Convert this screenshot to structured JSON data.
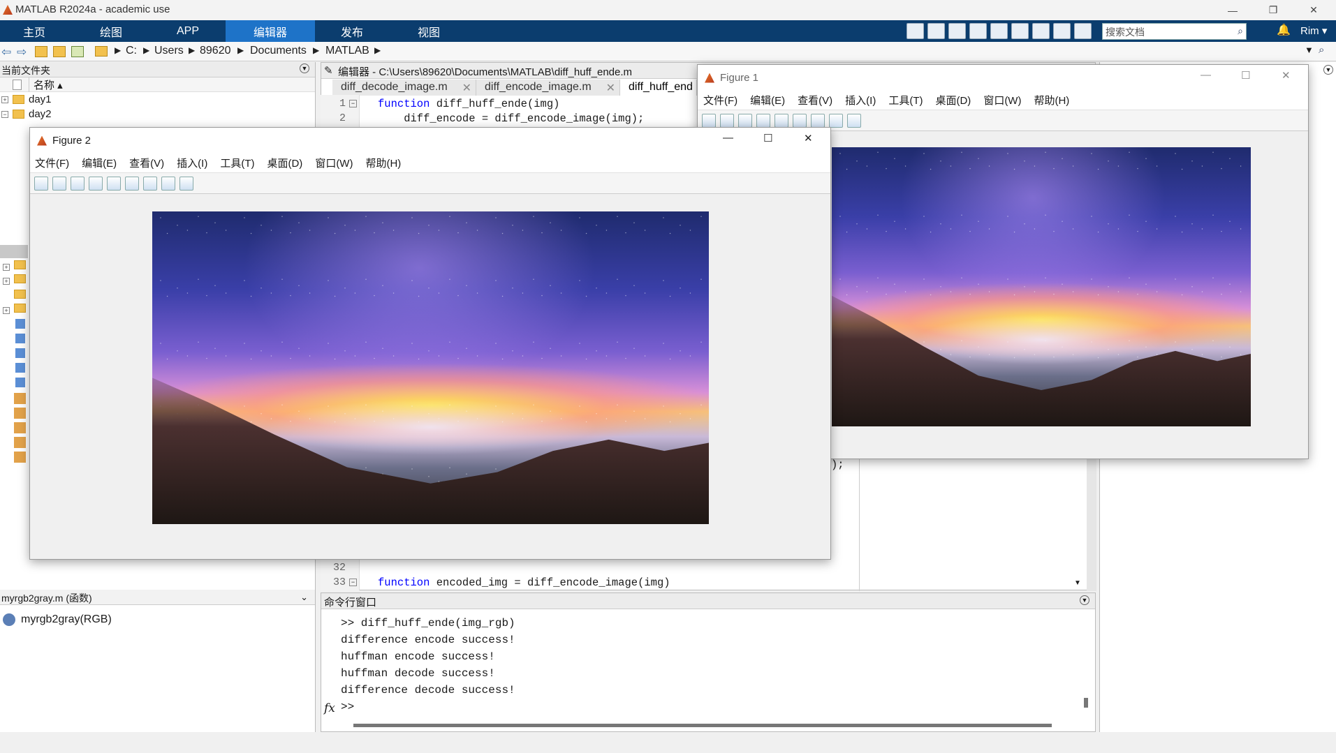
{
  "window": {
    "title": "MATLAB R2024a - academic use"
  },
  "ribbon": {
    "tabs": [
      "主页",
      "绘图",
      "APP",
      "编辑器",
      "发布",
      "视图"
    ],
    "active_tab": "编辑器",
    "search_placeholder": "搜索文档",
    "user": "Rim ▾"
  },
  "address": {
    "parts": [
      "C:",
      "Users",
      "89620",
      "Documents",
      "MATLAB"
    ]
  },
  "current_folder": {
    "title": "当前文件夹",
    "column_name": "名称 ▴",
    "items": [
      "day1",
      "day2"
    ]
  },
  "details": {
    "title": "myrgb2gray.m  (函数)",
    "function_sig": "myrgb2gray(RGB)"
  },
  "editor": {
    "header": "编辑器 - C:\\Users\\89620\\Documents\\MATLAB\\diff_huff_ende.m",
    "tabs": [
      "diff_decode_image.m",
      "diff_encode_image.m",
      "diff_huff_end"
    ],
    "active_tab": "diff_huff_end",
    "lines": [
      {
        "num": "1",
        "kw": "function",
        "code": " diff_huff_ende(img)"
      },
      {
        "num": "2",
        "kw": "",
        "code": "    diff_encode = diff_encode_image(img);"
      }
    ],
    "lines_bottom": [
      {
        "num": "32",
        "kw": "",
        "code": ""
      },
      {
        "num": "33",
        "kw": "function",
        "code": " encoded_img = diff_encode_image(img)"
      }
    ],
    "partial_visible": ");"
  },
  "command_window": {
    "title": "命令行窗口",
    "lines": [
      ">> diff_huff_ende(img_rgb)",
      "difference encode success!",
      "huffman encode success!",
      "huffman decode success!",
      "difference decode success!"
    ],
    "prompt": ">>",
    "fx": "fx"
  },
  "figure1": {
    "title": "Figure 1",
    "menu": [
      "文件(F)",
      "编辑(E)",
      "查看(V)",
      "插入(I)",
      "工具(T)",
      "桌面(D)",
      "窗口(W)",
      "帮助(H)"
    ]
  },
  "figure2": {
    "title": "Figure 2",
    "menu": [
      "文件(F)",
      "编辑(E)",
      "查看(V)",
      "插入(I)",
      "工具(T)",
      "桌面(D)",
      "窗口(W)",
      "帮助(H)"
    ]
  },
  "colors": {
    "ribbon_bg": "#0b3d6e",
    "ribbon_active": "#1e73c8",
    "keyword": "#0000ff"
  }
}
